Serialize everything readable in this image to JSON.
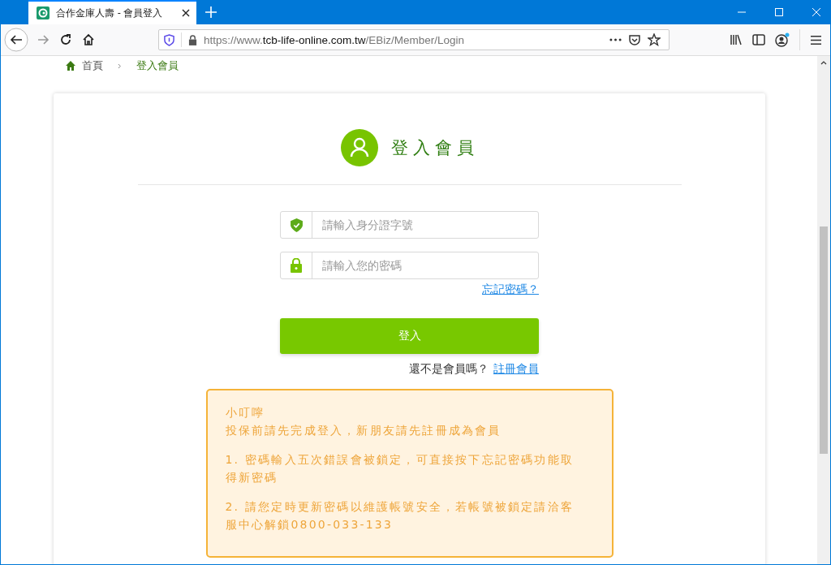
{
  "browser": {
    "tab": {
      "title": "合作金庫人壽 - 會員登入",
      "selected": true
    },
    "url": {
      "prefix": "https://www.",
      "domain": "tcb-life-online.com.tw",
      "path": "/EBiz/Member/Login"
    },
    "account_notification": true
  },
  "breadcrumb": [
    {
      "label": "首頁",
      "kind": "home"
    },
    {
      "label": "登入會員",
      "kind": "current"
    }
  ],
  "login": {
    "title": "登入會員",
    "fields": [
      {
        "kind": "id",
        "placeholder": "請輸入身分證字號"
      },
      {
        "kind": "password",
        "placeholder": "請輸入您的密碼"
      }
    ],
    "forgot_link": "忘記密碼？",
    "submit": "登入",
    "register_prompt": "還不是會員嗎？",
    "register_link": "註冊會員"
  },
  "notice": {
    "title": "小叮嚀",
    "intro": "投保前請先完成登入，新朋友請先註冊成為會員",
    "items": [
      "1. 密碼輸入五次錯誤會被鎖定，可直接按下忘記密碼功能取得新密碼",
      "2. 請您定時更新密碼以維護帳號安全，若帳號被鎖定請洽客服中心解鎖0800-033-133"
    ]
  }
}
